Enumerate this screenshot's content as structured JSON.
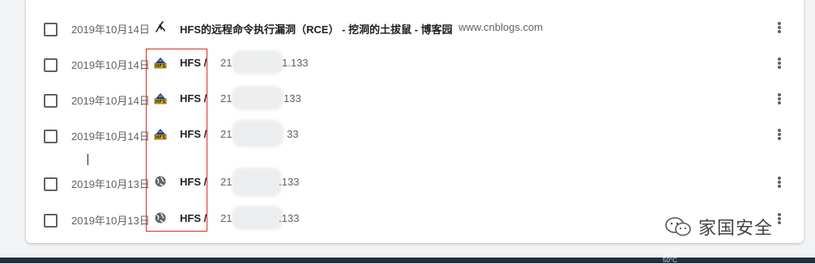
{
  "rows": [
    {
      "date": "2019年10月14日",
      "favicon": "cnblogs-icon",
      "title": "HFS的远程命令执行漏洞（RCE） - 挖洞的土拔鼠 - 博客园",
      "domain": "www.cnblogs.com",
      "ip_prefix": "",
      "ip_suffix": ""
    },
    {
      "date": "2019年10月14日",
      "favicon": "hfs-icon",
      "title": "HFS /",
      "domain": "",
      "ip_prefix": "21",
      "ip_suffix": "1.133"
    },
    {
      "date": "2019年10月14日",
      "favicon": "hfs-icon",
      "title": "HFS /",
      "domain": "",
      "ip_prefix": "21",
      "ip_suffix": "133"
    },
    {
      "date": "2019年10月14日",
      "favicon": "hfs-icon",
      "title": "HFS /",
      "domain": "",
      "ip_prefix": "21",
      "ip_suffix": "33"
    },
    {
      "date": "2019年10月13日",
      "favicon": "globe-icon",
      "title": "HFS /",
      "domain": "",
      "ip_prefix": "21",
      "ip_suffix": ".133"
    },
    {
      "date": "2019年10月13日",
      "favicon": "globe-icon",
      "title": "HFS /",
      "domain": "",
      "ip_prefix": "21",
      "ip_suffix": ".133"
    }
  ],
  "watermark": "家国安全",
  "taskbar_temp": "50°C",
  "colors": {
    "highlight_box": "#d93025",
    "card_bg": "#ffffff",
    "page_bg": "#f1f3f4",
    "taskbar": "#1f2f3f"
  }
}
